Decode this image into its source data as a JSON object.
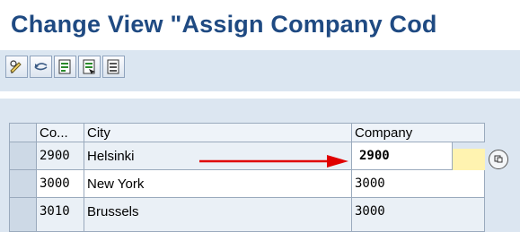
{
  "title": "Change View \"Assign Company Cod",
  "toolbar": {
    "buttons": [
      "display-change-icon",
      "refresh-icon",
      "doc-save-icon",
      "doc-select-icon",
      "doc-details-icon"
    ]
  },
  "table": {
    "headers": {
      "co": "Co...",
      "city": "City",
      "company": "Company"
    },
    "rows": [
      {
        "co": "2900",
        "city": "Helsinki",
        "company": "2900"
      },
      {
        "co": "3000",
        "city": "New York",
        "company": "3000"
      },
      {
        "co": "3010",
        "city": "Brussels",
        "company": "3000"
      }
    ]
  },
  "colors": {
    "title": "#1f4a82",
    "arrow": "#e00000",
    "focus": "#fff3b0",
    "grid_bg": "#dce6f1"
  }
}
